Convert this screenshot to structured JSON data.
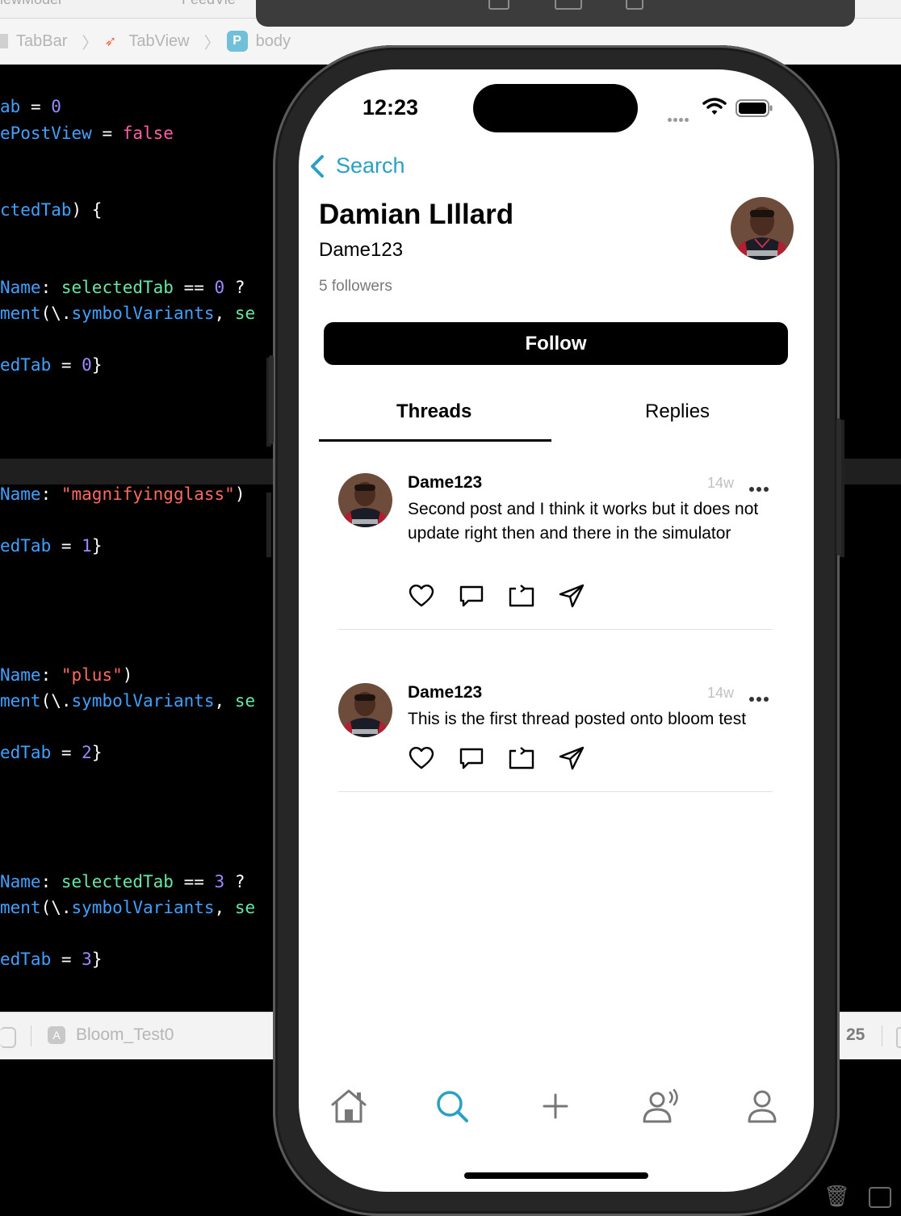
{
  "xcode": {
    "top_left_text": "iewModel",
    "top_mid_text": "FeedVie",
    "breadcrumb": [
      "TabBar",
      "TabView",
      "body"
    ],
    "code_lines": [
      {
        "tokens": [
          [
            "c-b",
            "ab"
          ],
          [
            "c-w",
            " = "
          ],
          [
            "c-n",
            "0"
          ]
        ]
      },
      {
        "tokens": [
          [
            "c-b",
            "ePostView"
          ],
          [
            "c-w",
            " = "
          ],
          [
            "c-p",
            "false"
          ]
        ]
      },
      {
        "tokens": [
          [
            "c-b",
            "ctedTab"
          ],
          [
            "c-w",
            ") {"
          ]
        ]
      },
      {
        "tokens": [
          [
            "c-b",
            "Name"
          ],
          [
            "c-w",
            ": "
          ],
          [
            "c-g",
            "selectedTab"
          ],
          [
            "c-w",
            " == "
          ],
          [
            "c-n",
            "0"
          ],
          [
            "c-w",
            " ?"
          ]
        ]
      },
      {
        "tokens": [
          [
            "c-b",
            "ment"
          ],
          [
            "c-w",
            "(\\."
          ],
          [
            "c-b",
            "symbolVariants"
          ],
          [
            "c-w",
            ", "
          ],
          [
            "c-g",
            "se"
          ]
        ]
      },
      {
        "tokens": [
          [
            "c-b",
            "edTab"
          ],
          [
            "c-w",
            " = "
          ],
          [
            "c-n",
            "0"
          ],
          [
            "c-w",
            "}"
          ]
        ]
      },
      {
        "tokens": [
          [
            "c-b",
            "Name"
          ],
          [
            "c-w",
            ": "
          ],
          [
            "c-r",
            "\"magnifyingglass\""
          ],
          [
            "c-w",
            ")"
          ]
        ]
      },
      {
        "tokens": [
          [
            "c-b",
            "edTab"
          ],
          [
            "c-w",
            " = "
          ],
          [
            "c-n",
            "1"
          ],
          [
            "c-w",
            "}"
          ]
        ]
      },
      {
        "tokens": [
          [
            "c-b",
            "Name"
          ],
          [
            "c-w",
            ": "
          ],
          [
            "c-r",
            "\"plus\""
          ],
          [
            "c-w",
            ")"
          ]
        ]
      },
      {
        "tokens": [
          [
            "c-b",
            "ment"
          ],
          [
            "c-w",
            "(\\."
          ],
          [
            "c-b",
            "symbolVariants"
          ],
          [
            "c-w",
            ", "
          ],
          [
            "c-g",
            "se"
          ]
        ]
      },
      {
        "tokens": [
          [
            "c-b",
            "edTab"
          ],
          [
            "c-w",
            " = "
          ],
          [
            "c-n",
            "2"
          ],
          [
            "c-w",
            "}"
          ]
        ]
      },
      {
        "tokens": [
          [
            "c-b",
            "Name"
          ],
          [
            "c-w",
            ": "
          ],
          [
            "c-g",
            "selectedTab"
          ],
          [
            "c-w",
            " == "
          ],
          [
            "c-n",
            "3"
          ],
          [
            "c-w",
            " ?"
          ]
        ]
      },
      {
        "tokens": [
          [
            "c-b",
            "ment"
          ],
          [
            "c-w",
            "(\\."
          ],
          [
            "c-b",
            "symbolVariants"
          ],
          [
            "c-w",
            ", "
          ],
          [
            "c-g",
            "se"
          ]
        ]
      },
      {
        "tokens": [
          [
            "c-b",
            "edTab"
          ],
          [
            "c-w",
            " = "
          ],
          [
            "c-n",
            "3"
          ],
          [
            "c-w",
            "}"
          ]
        ]
      }
    ],
    "status_scheme": "Bloom_Test0",
    "status_line": "25"
  },
  "phone": {
    "status_time": "12:23",
    "back_label": "Search",
    "profile": {
      "name": "Damian LIllard",
      "handle": "Dame123",
      "followers": "5 followers",
      "follow_label": "Follow"
    },
    "tabs": {
      "threads": "Threads",
      "replies": "Replies",
      "selected": "Threads"
    },
    "threads": [
      {
        "username": "Dame123",
        "time": "14w",
        "body": "Second post and I think it works but it does not update right then and there in the simulator"
      },
      {
        "username": "Dame123",
        "time": "14w",
        "body": "This is the first thread posted onto bloom test"
      }
    ],
    "tabbar": [
      "home-icon",
      "search-icon",
      "plus-icon",
      "activity-icon",
      "profile-icon"
    ],
    "tabbar_selected": "search-icon",
    "colors": {
      "accent": "#2aa1c4",
      "text": "#000000",
      "muted": "#7a7a7a"
    }
  }
}
